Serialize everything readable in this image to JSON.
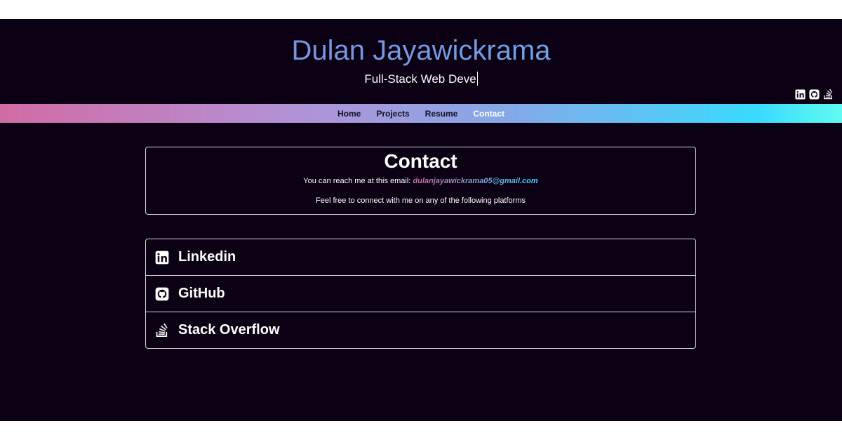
{
  "header": {
    "title": "Dulan Jayawickrama",
    "subtitle": "Full-Stack Web Deve",
    "social_icons": [
      "linkedin-icon",
      "github-icon",
      "stackoverflow-icon"
    ]
  },
  "nav": {
    "items": [
      {
        "label": "Home",
        "active": false
      },
      {
        "label": "Projects",
        "active": false
      },
      {
        "label": "Resume",
        "active": false
      },
      {
        "label": "Contact",
        "active": true
      }
    ]
  },
  "contact": {
    "heading": "Contact",
    "email_prefix": "You can reach me at this email: ",
    "email": "dulanjayawickrama05@gmail.com",
    "connect_text": "Feel free to connect with me on any of the following platforms"
  },
  "platforms": [
    {
      "label": "Linkedin",
      "icon": "linkedin-icon"
    },
    {
      "label": "GitHub",
      "icon": "github-icon"
    },
    {
      "label": "Stack Overflow",
      "icon": "stackoverflow-icon"
    }
  ],
  "colors": {
    "background": "#0b0014",
    "gradient": [
      "#d16ba5",
      "#86a8e7",
      "#3adafe",
      "#5ffbf1"
    ],
    "text": "#ffffff"
  }
}
